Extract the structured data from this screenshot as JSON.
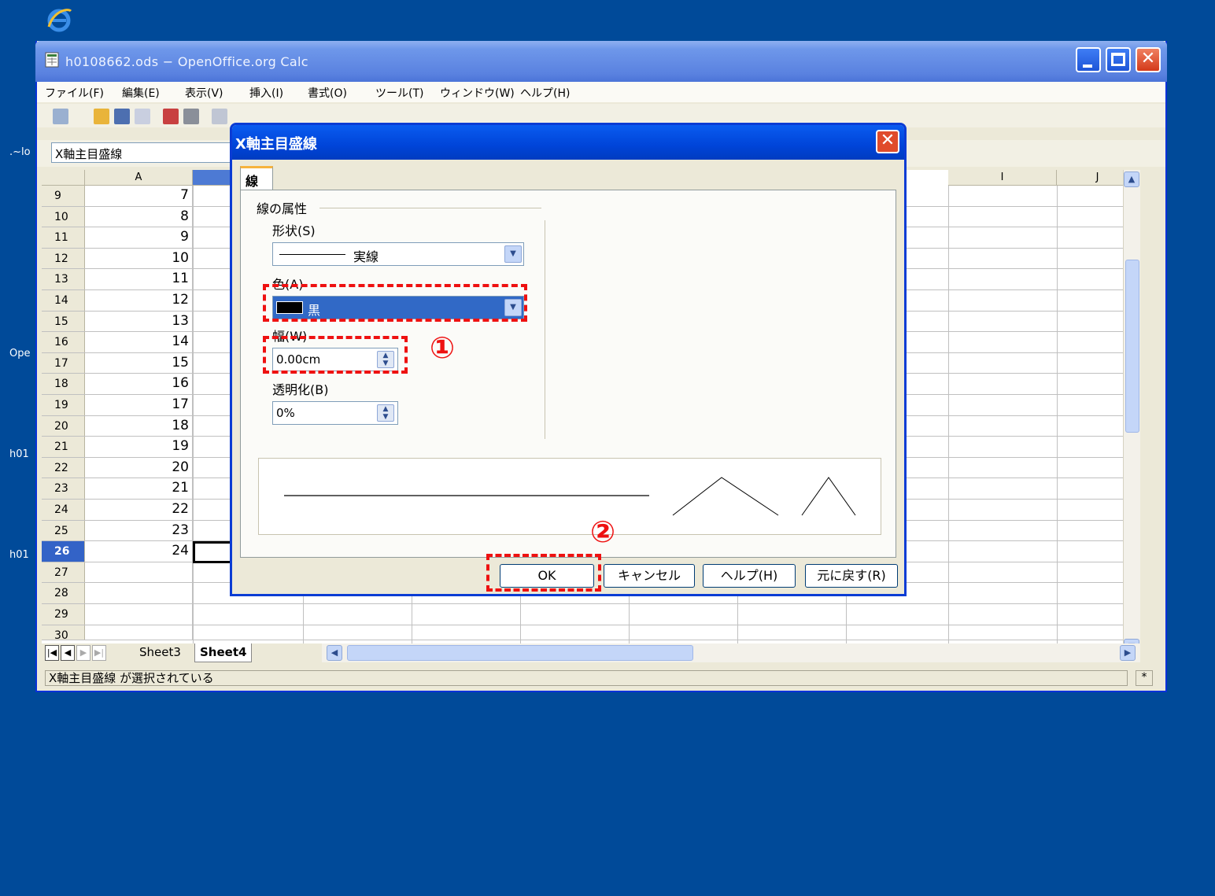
{
  "window": {
    "title": "h0108662.ods − OpenOffice.org Calc"
  },
  "menu": [
    "ファイル(F)",
    "編集(E)",
    "表示(V)",
    "挿入(I)",
    "書式(O)",
    "ツール(T)",
    "ウィンドウ(W)",
    "ヘルプ(H)"
  ],
  "side_labels": [
    ".~lo",
    "Ope",
    "h01",
    "h01"
  ],
  "name_box": "X軸主目盛線",
  "columns": [
    "A",
    "I",
    "J"
  ],
  "rows": [
    {
      "n": "9",
      "a": "7"
    },
    {
      "n": "10",
      "a": "8"
    },
    {
      "n": "11",
      "a": "9"
    },
    {
      "n": "12",
      "a": "10"
    },
    {
      "n": "13",
      "a": "11"
    },
    {
      "n": "14",
      "a": "12"
    },
    {
      "n": "15",
      "a": "13"
    },
    {
      "n": "16",
      "a": "14"
    },
    {
      "n": "17",
      "a": "15"
    },
    {
      "n": "18",
      "a": "16"
    },
    {
      "n": "19",
      "a": "17"
    },
    {
      "n": "20",
      "a": "18"
    },
    {
      "n": "21",
      "a": "19"
    },
    {
      "n": "22",
      "a": "20"
    },
    {
      "n": "23",
      "a": "21"
    },
    {
      "n": "24",
      "a": "22"
    },
    {
      "n": "25",
      "a": "23"
    },
    {
      "n": "26",
      "a": "24"
    },
    {
      "n": "27",
      "a": ""
    },
    {
      "n": "28",
      "a": ""
    },
    {
      "n": "29",
      "a": ""
    },
    {
      "n": "30",
      "a": ""
    }
  ],
  "sheet_tabs": [
    "Sheet3",
    "Sheet4"
  ],
  "status_text": "X軸主目盛線 が選択されている",
  "status_star": "*",
  "dialog": {
    "title": "X軸主目盛線",
    "tab": "線",
    "group": "線の属性",
    "style_label": "形状(S)",
    "style_value": "実線",
    "color_label": "色(A)",
    "color_value": "黒",
    "width_label": "幅(W)",
    "width_value": "0.00cm",
    "transparency_label": "透明化(B)",
    "transparency_value": "0%",
    "buttons": {
      "ok": "OK",
      "cancel": "キャンセル",
      "help": "ヘルプ(H)",
      "reset": "元に戻す(R)"
    }
  },
  "annotations": {
    "one": "①",
    "two": "②"
  },
  "colors": {
    "highlight": "#e11",
    "desktop": "#004a99"
  }
}
